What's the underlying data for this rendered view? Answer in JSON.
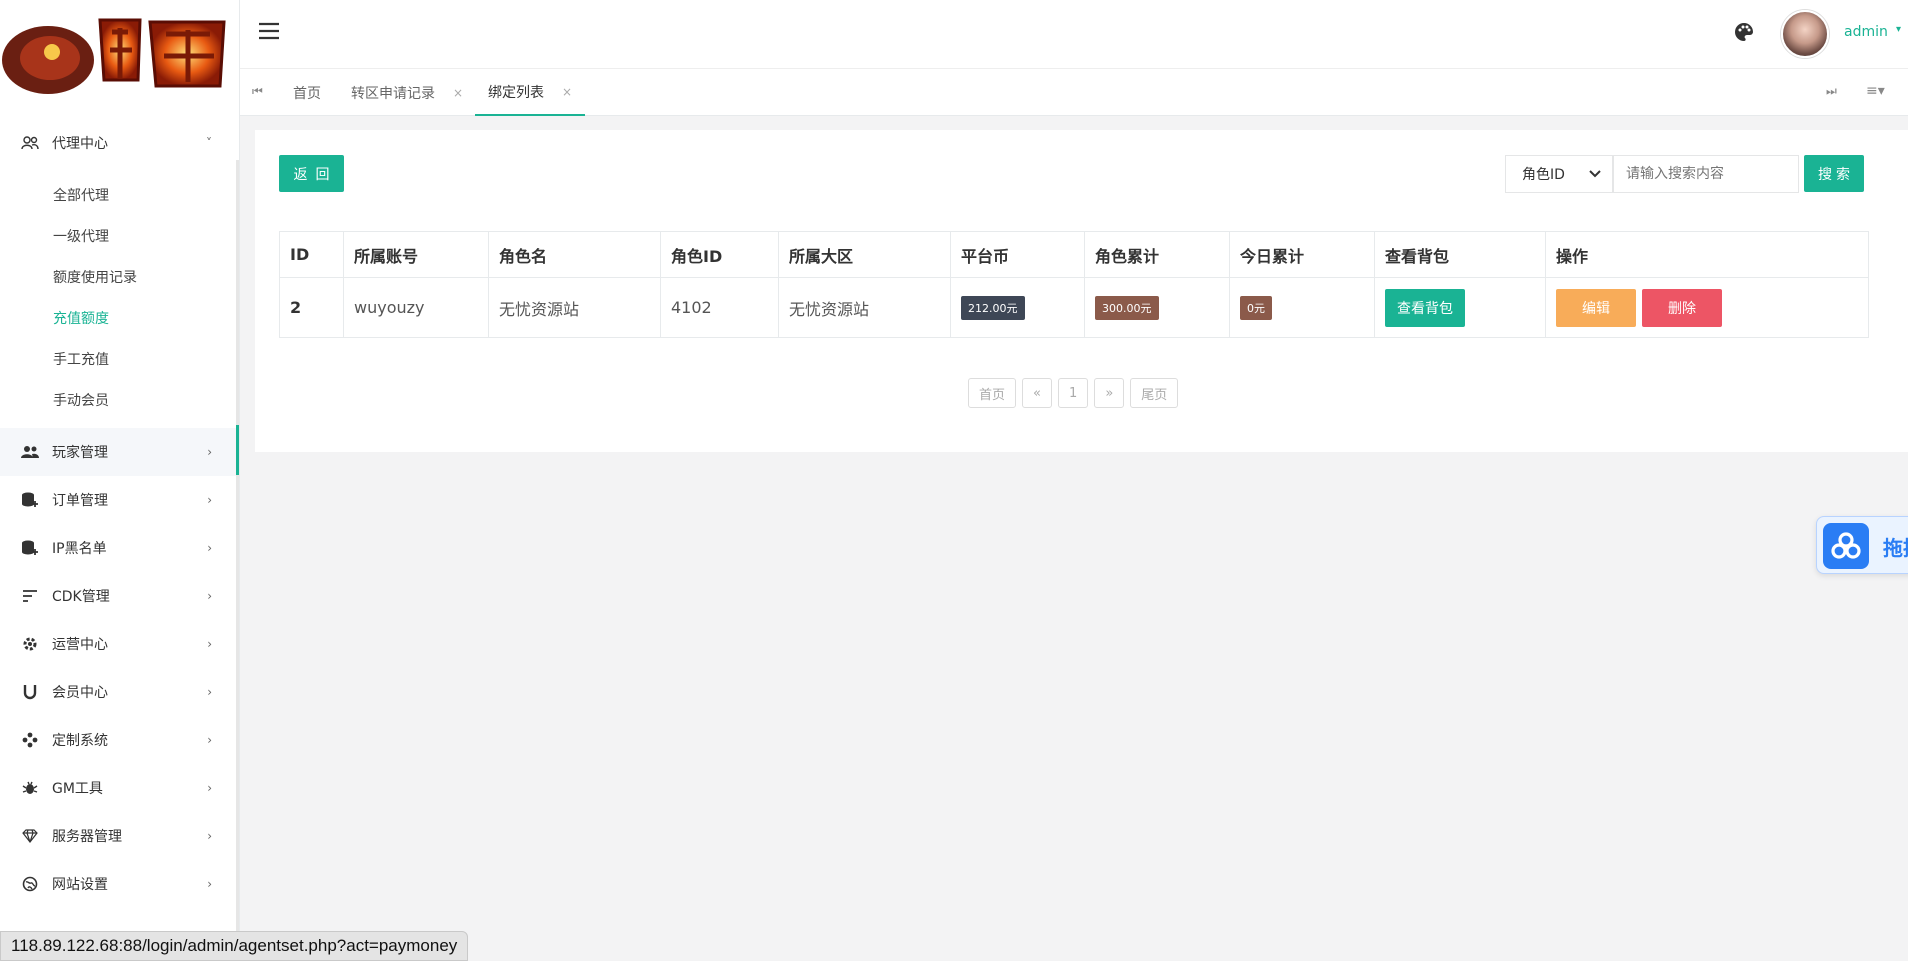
{
  "sidebar": {
    "group_open": {
      "label": "代理中心",
      "chev": "˅",
      "icon": "users-outline-icon"
    },
    "sub_items": [
      {
        "label": "全部代理",
        "active": false
      },
      {
        "label": "一级代理",
        "active": false
      },
      {
        "label": "额度使用记录",
        "active": false
      },
      {
        "label": "充值额度",
        "active": true
      },
      {
        "label": "手工充值",
        "active": false
      },
      {
        "label": "手动会员",
        "active": false
      }
    ],
    "items": [
      {
        "label": "玩家管理",
        "chev": "›",
        "icon": "users-icon"
      },
      {
        "label": "订单管理",
        "chev": "›",
        "icon": "database-add-icon"
      },
      {
        "label": "IP黑名单",
        "chev": "›",
        "icon": "database-add-icon"
      },
      {
        "label": "CDK管理",
        "chev": "›",
        "icon": "list-icon"
      },
      {
        "label": "运营中心",
        "chev": "›",
        "icon": "gear-icon"
      },
      {
        "label": "会员中心",
        "chev": "›",
        "icon": "magnet-icon"
      },
      {
        "label": "定制系统",
        "chev": "›",
        "icon": "nodes-icon"
      },
      {
        "label": "GM工具",
        "chev": "›",
        "icon": "bug-icon"
      },
      {
        "label": "服务器管理",
        "chev": "›",
        "icon": "diamond-icon"
      },
      {
        "label": "网站设置",
        "chev": "›",
        "icon": "globe-icon"
      }
    ]
  },
  "topbar": {
    "user_name": "admin",
    "user_caret": "▾"
  },
  "tabs": {
    "nav_left": "⏮",
    "nav_right": "⏭",
    "nav_menu": "≡▾",
    "items": [
      {
        "label": "首页",
        "closable": false,
        "active": false
      },
      {
        "label": "转区申请记录",
        "closable": true,
        "active": false
      },
      {
        "label": "绑定列表",
        "closable": true,
        "active": true
      }
    ],
    "close_glyph": "×"
  },
  "toolbar": {
    "back_label": "返回",
    "select_value": "角色ID",
    "search_placeholder": "请输入搜索内容",
    "search_label": "搜索"
  },
  "table": {
    "headers": [
      "ID",
      "所属账号",
      "角色名",
      "角色ID",
      "所属大区",
      "平台币",
      "角色累计",
      "今日累计",
      "查看背包",
      "操作"
    ],
    "rows": [
      {
        "id": "2",
        "account": "wuyouzy",
        "role_name": "无忧资源站",
        "role_id": "4102",
        "zone": "无忧资源站",
        "coins": "212.00元",
        "role_total": "300.00元",
        "today_total": "0元",
        "bag_button": "查看背包",
        "edit_button": "编辑",
        "delete_button": "删除"
      }
    ]
  },
  "pagination": {
    "first": "首页",
    "prev": "«",
    "current": "1",
    "next": "»",
    "last": "尾页"
  },
  "float_widget": {
    "label": "拖拽"
  },
  "status_url": "118.89.122.68:88/login/admin/agentset.php?act=paymoney",
  "colors": {
    "accent": "#1ab394",
    "warning": "#f8ac59",
    "danger": "#ed5565"
  }
}
